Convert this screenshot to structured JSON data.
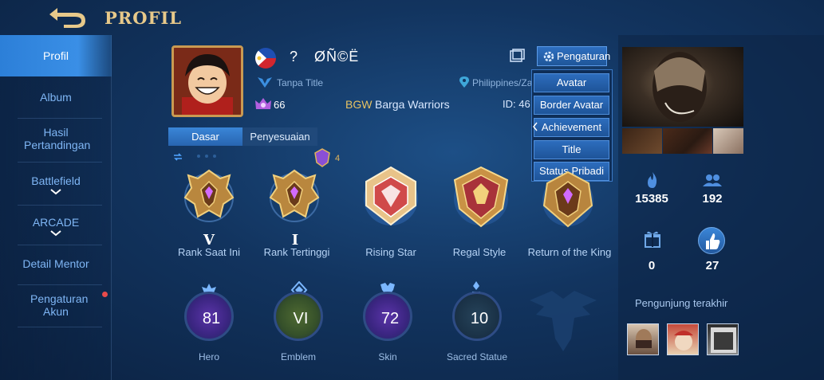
{
  "header": {
    "title": "PROFIL"
  },
  "sidebar": {
    "items": [
      {
        "label": "Profil"
      },
      {
        "label": "Album"
      },
      {
        "label": "Hasil Pertandingan"
      },
      {
        "label": "Battlefield"
      },
      {
        "label": "ARCADE"
      },
      {
        "label": "Detail Mentor"
      },
      {
        "label": "Pengaturan Akun"
      }
    ]
  },
  "profile": {
    "name_prefix": "?",
    "name": "ØÑ©Ë",
    "title": "Tanpa Title",
    "level": "66",
    "squad_tag": "BGW",
    "squad_name": "Barga Warriors",
    "location": "Philippines/Za",
    "id_label": "ID: 46"
  },
  "settings": {
    "label": "Pengaturan",
    "menu": [
      "Avatar",
      "Border Avatar",
      "Achievement",
      "Title",
      "Status Pribadi"
    ]
  },
  "tabs": [
    "Dasar",
    "Penyesuaian"
  ],
  "ranks": {
    "peak_count": "4",
    "items": [
      {
        "numeral": "V",
        "label": "Rank Saat Ini"
      },
      {
        "numeral": "I",
        "label": "Rank Tertinggi"
      },
      {
        "numeral": "",
        "label": "Rising Star"
      },
      {
        "numeral": "",
        "label": "Regal Style"
      },
      {
        "numeral": "",
        "label": "Return of the King"
      }
    ]
  },
  "stats": [
    {
      "value": "81",
      "label": "Hero",
      "color": "#6a3fb8"
    },
    {
      "value": "VI",
      "label": "Emblem",
      "color": "#5c7a3a"
    },
    {
      "value": "72",
      "label": "Skin",
      "color": "#6a3fb8"
    },
    {
      "value": "10",
      "label": "Sacred Statue",
      "color": "#2f4f63"
    }
  ],
  "right": {
    "popularity": "15385",
    "followers": "192",
    "gifts": "0",
    "likes": "27",
    "visitors_label": "Pengunjung terakhir"
  },
  "colors": {
    "gold": "#e7c98a",
    "accent": "#3a8fe6"
  }
}
